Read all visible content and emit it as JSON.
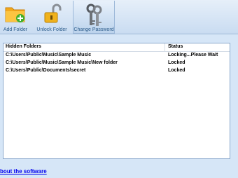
{
  "toolbar": {
    "add_folder_label": "Add Folder",
    "unlock_folder_label": "Unlock Folder",
    "change_password_label": "Change Password"
  },
  "list": {
    "headers": [
      "Hidden Folders",
      "Status"
    ],
    "rows": [
      {
        "path": "C:\\Users\\Public\\Music\\Sample Music",
        "status": "Locking...Please Wait"
      },
      {
        "path": "C:\\Users\\Public\\Music\\Sample Music\\New folder",
        "status": "Locked"
      },
      {
        "path": "C:\\Users\\Public\\Documents\\secret",
        "status": "Locked"
      }
    ]
  },
  "footer": {
    "about_link": "bout the software"
  }
}
